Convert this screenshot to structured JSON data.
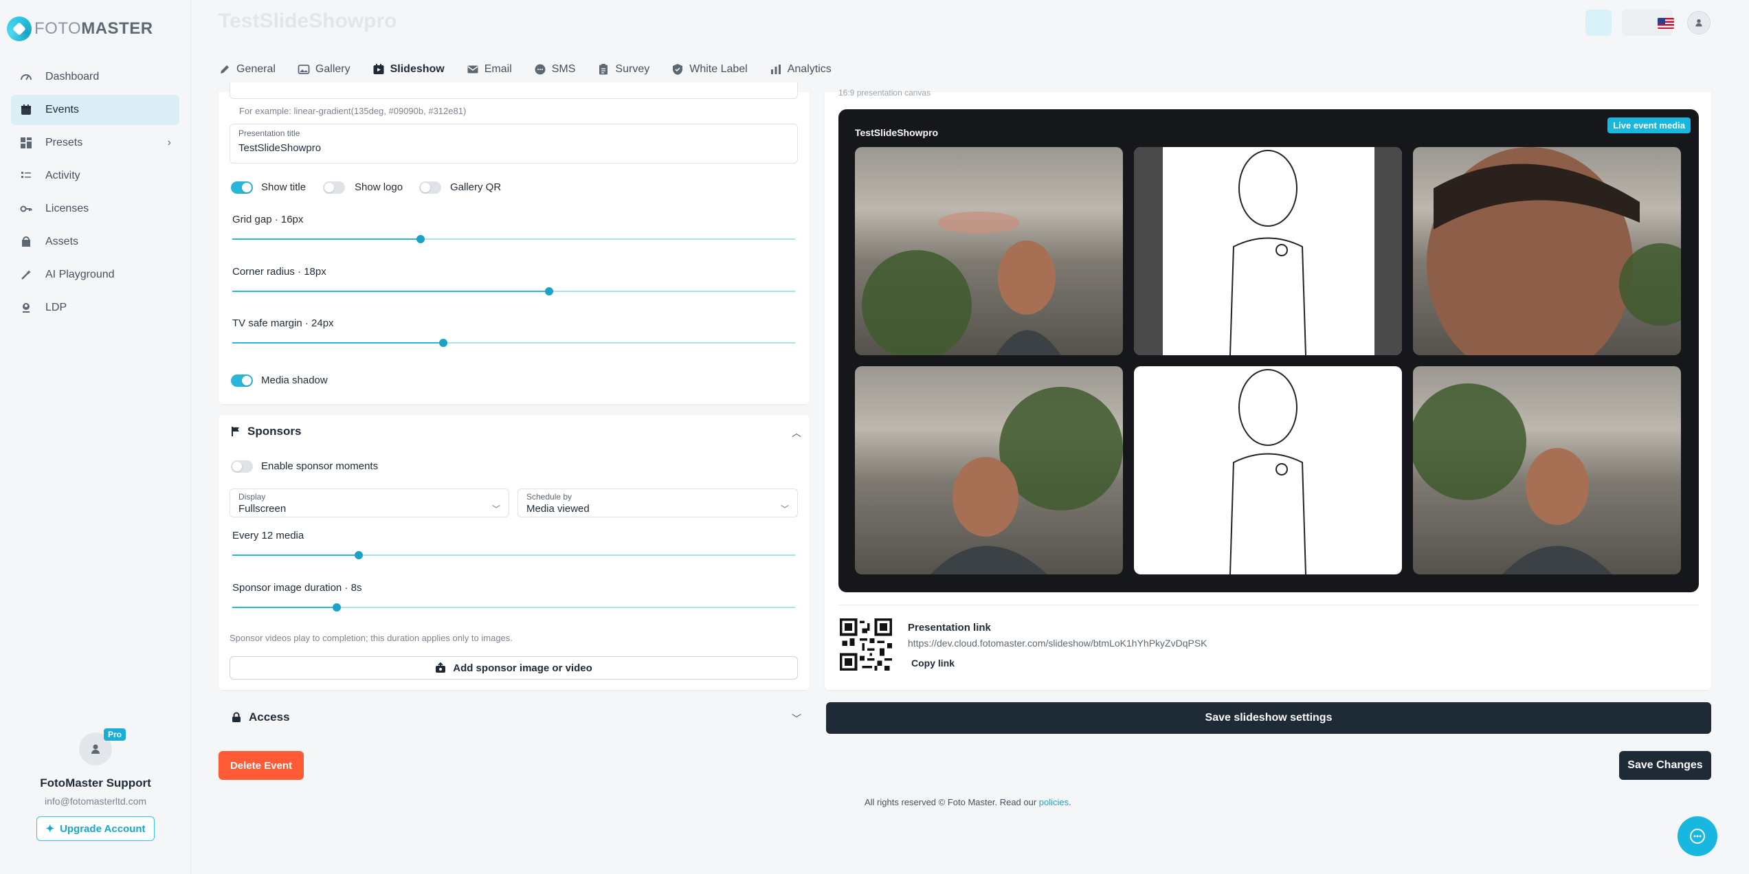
{
  "brand": {
    "logo_light": "FOTO",
    "logo_bold": "MASTER"
  },
  "sidebar": {
    "items": [
      {
        "label": "Dashboard",
        "icon": "gauge-icon"
      },
      {
        "label": "Events",
        "icon": "calendar-icon",
        "active": true
      },
      {
        "label": "Presets",
        "icon": "grid-icon",
        "has_chevron": true
      },
      {
        "label": "Activity",
        "icon": "activity-icon"
      },
      {
        "label": "Licenses",
        "icon": "key-icon"
      },
      {
        "label": "Assets",
        "icon": "box-icon"
      },
      {
        "label": "AI Playground",
        "icon": "wand-icon"
      },
      {
        "label": "LDP",
        "icon": "user-pin-icon"
      }
    ],
    "profile": {
      "badge": "Pro",
      "name": "FotoMaster Support",
      "email": "info@fotomasterltd.com",
      "upgrade_label": "Upgrade Account"
    }
  },
  "header": {
    "event_title": "TestSlideShowpro"
  },
  "tabs": [
    {
      "label": "General",
      "icon": "pencil-icon"
    },
    {
      "label": "Gallery",
      "icon": "image-icon"
    },
    {
      "label": "Slideshow",
      "icon": "slideshow-icon",
      "active": true
    },
    {
      "label": "Email",
      "icon": "mail-icon"
    },
    {
      "label": "SMS",
      "icon": "chat-icon"
    },
    {
      "label": "Survey",
      "icon": "clipboard-icon"
    },
    {
      "label": "White Label",
      "icon": "shield-icon"
    },
    {
      "label": "Analytics",
      "icon": "bar-chart-icon"
    }
  ],
  "appearance": {
    "gradient_hint": "For example: linear-gradient(135deg, #09090b, #312e81)",
    "presentation_title_label": "Presentation title",
    "presentation_title_value": "TestSlideShowpro",
    "toggles": [
      {
        "label": "Show title",
        "on": true
      },
      {
        "label": "Show logo",
        "on": false
      },
      {
        "label": "Gallery QR",
        "on": false
      }
    ],
    "sliders": [
      {
        "label": "Grid gap · 16px",
        "fraction": 0.335
      },
      {
        "label": "Corner radius · 18px",
        "fraction": 0.563
      },
      {
        "label": "TV safe margin · 24px",
        "fraction": 0.375
      }
    ],
    "media_shadow_label": "Media shadow",
    "media_shadow_on": true
  },
  "sponsors": {
    "title": "Sponsors",
    "enable_label": "Enable sponsor moments",
    "enable_on": false,
    "display_label": "Display",
    "display_value": "Fullscreen",
    "schedule_label": "Schedule by",
    "schedule_value": "Media viewed",
    "every_label": "Every 12 media",
    "every_fraction": 0.225,
    "duration_label": "Sponsor image duration · 8s",
    "duration_fraction": 0.186,
    "note": "Sponsor videos play to completion; this duration applies only to images.",
    "add_label": "Add sponsor image or video"
  },
  "access": {
    "title": "Access"
  },
  "actions": {
    "delete": "Delete Event",
    "save_slideshow": "Save slideshow settings",
    "save_changes": "Save Changes"
  },
  "preview": {
    "caption": "16:9 presentation canvas",
    "title": "TestSlideShowpro",
    "badge": "Live event media",
    "tiles": [
      "photo",
      "sketch",
      "photo",
      "photo",
      "sketch",
      "photo"
    ]
  },
  "link": {
    "title": "Presentation link",
    "url": "https://dev.cloud.fotomaster.com/slideshow/btmLoK1hYhPkyZvDqPSK",
    "copy": "Copy link"
  },
  "footer": {
    "text": "All rights reserved © Foto Master. Read our ",
    "link": "policies",
    "end": "."
  },
  "colors": {
    "accent": "#29b6d8",
    "dark": "#1e2a36",
    "danger": "#ff5a36"
  }
}
